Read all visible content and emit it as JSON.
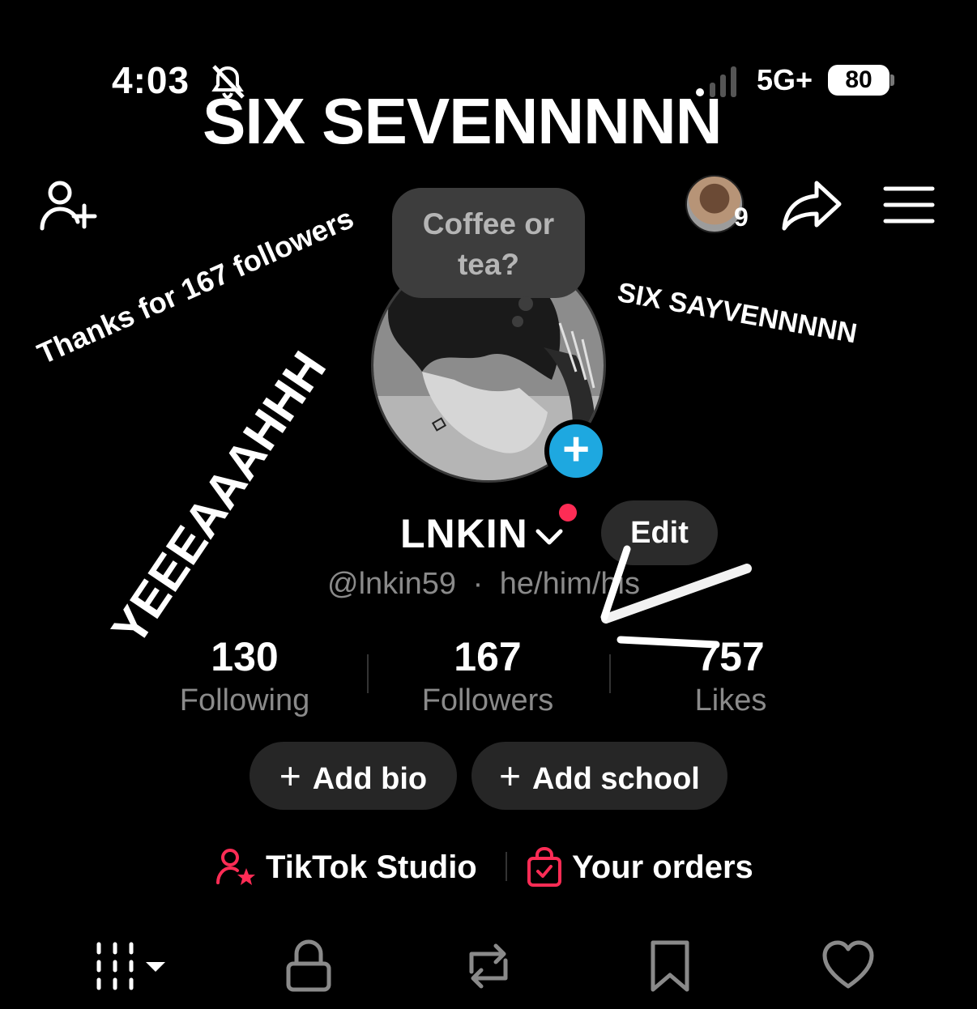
{
  "status_bar": {
    "time": "4:03",
    "network": "5G+",
    "battery": "80"
  },
  "overlay": {
    "title": "SIX SEVENNNNN",
    "sticker_thanks": "Thanks for 167 followers",
    "sticker_yeah": "YEEEAAAHHH",
    "sticker_six": "SIX SAYVENNNNN"
  },
  "header": {
    "visitors_count": "9"
  },
  "avatar": {
    "bubble_text": "Coffee or tea?"
  },
  "profile": {
    "display_name": "LNKIN",
    "edit_label": "Edit",
    "handle": "@lnkin59",
    "separator": "·",
    "pronouns": "he/him/his"
  },
  "stats": {
    "following": {
      "value": "130",
      "label": "Following"
    },
    "followers": {
      "value": "167",
      "label": "Followers"
    },
    "likes": {
      "value": "757",
      "label": "Likes"
    }
  },
  "actions": {
    "add_bio": "Add bio",
    "add_school": "Add school",
    "plus": "+"
  },
  "links": {
    "studio": "TikTok Studio",
    "orders": "Your orders"
  },
  "colors": {
    "accent_red": "#fe2c55",
    "accent_blue": "#1ea8e0",
    "pill_bg": "#262626"
  },
  "icons": {
    "tabs": [
      "grid-icon",
      "lock-icon",
      "repost-icon",
      "bookmark-icon",
      "heart-icon"
    ]
  }
}
